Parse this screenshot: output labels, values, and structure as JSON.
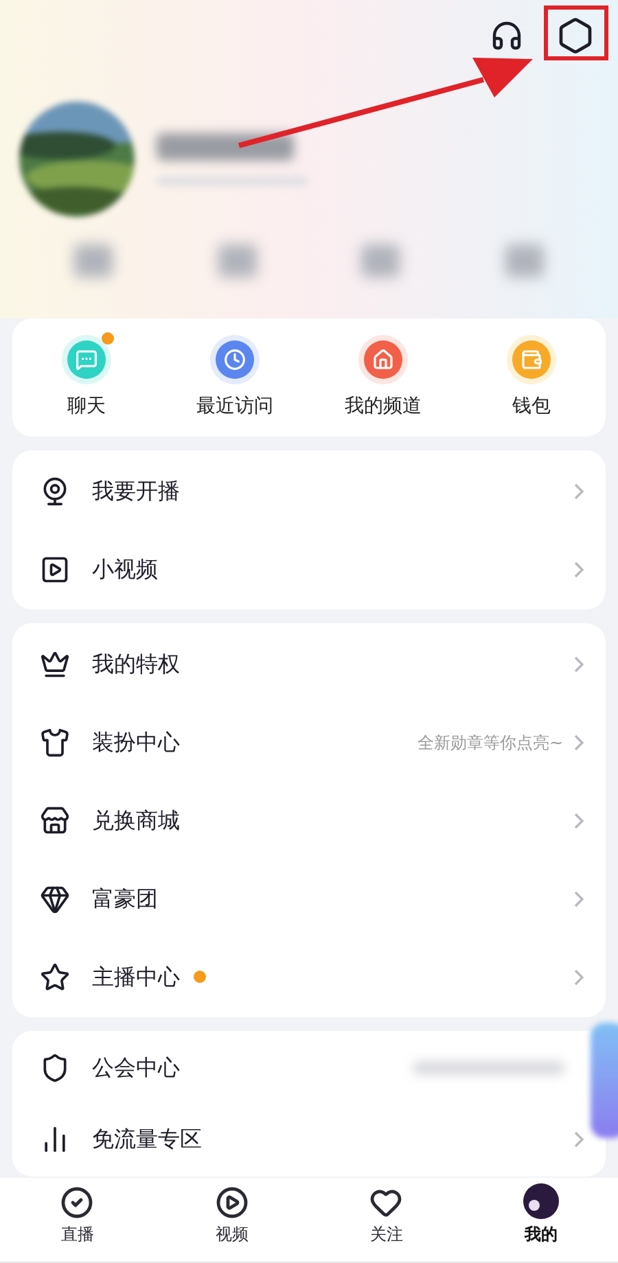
{
  "quick_actions": [
    {
      "kind": "chat",
      "label": "聊天",
      "badge": true
    },
    {
      "kind": "recent",
      "label": "最近访问",
      "badge": false
    },
    {
      "kind": "channel",
      "label": "我的频道",
      "badge": false
    },
    {
      "kind": "wallet",
      "label": "钱包",
      "badge": false
    }
  ],
  "sections": [
    {
      "items": [
        {
          "kind": "webcam",
          "label": "我要开播",
          "dot": false
        },
        {
          "kind": "video",
          "label": "小视频",
          "dot": false
        }
      ]
    },
    {
      "items": [
        {
          "kind": "crown",
          "label": "我的特权",
          "dot": false
        },
        {
          "kind": "shirt",
          "label": "装扮中心",
          "hint": "全新勋章等你点亮~",
          "dot": false
        },
        {
          "kind": "store",
          "label": "兑换商城",
          "dot": false
        },
        {
          "kind": "gem",
          "label": "富豪团",
          "dot": false
        },
        {
          "kind": "star",
          "label": "主播中心",
          "dot": true
        }
      ]
    },
    {
      "items": [
        {
          "kind": "shield",
          "label": "公会中心",
          "dot": false,
          "blurred_hint": true
        },
        {
          "kind": "chart",
          "label": "免流量专区",
          "dot": false
        }
      ]
    }
  ],
  "tab_bar": [
    {
      "kind": "live",
      "label": "直播",
      "selected": false
    },
    {
      "kind": "video",
      "label": "视频",
      "selected": false
    },
    {
      "kind": "heart",
      "label": "关注",
      "selected": false
    },
    {
      "kind": "avatar",
      "label": "我的",
      "selected": true
    }
  ]
}
